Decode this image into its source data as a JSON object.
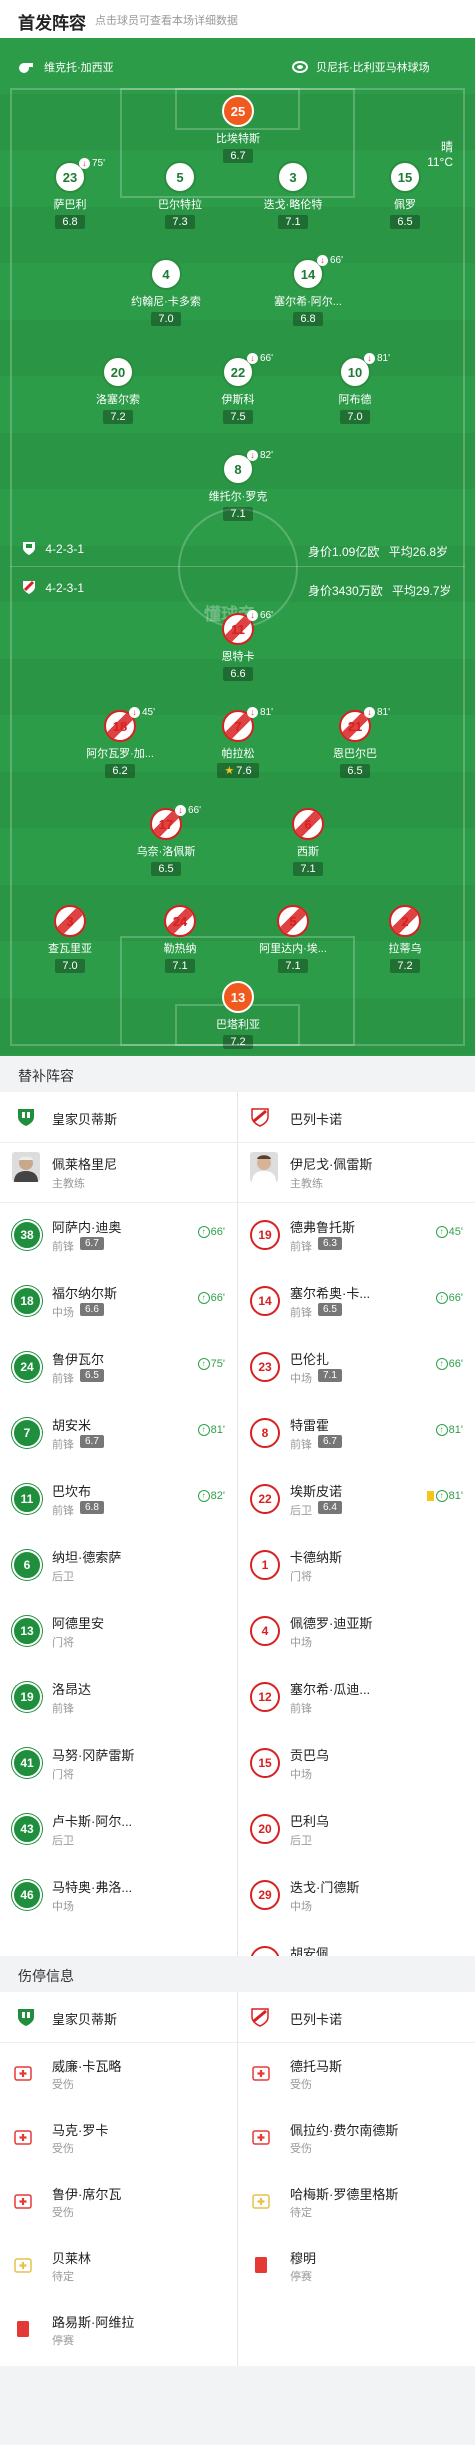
{
  "header": {
    "title": "首发阵容",
    "hint": "点击球员可查看本场详细数据"
  },
  "match": {
    "home_venue": "维克托·加西亚",
    "away_venue": "贝尼托·比利亚马林球场",
    "weather": "晴",
    "temperature": "11°C",
    "watermark": "懂球帝"
  },
  "home": {
    "formation": "4-2-3-1",
    "value": "身价1.09亿欧",
    "age": "平均26.8岁",
    "lineup": [
      {
        "num": "25",
        "name": "比埃特斯",
        "rating": "6.7",
        "gk": true
      },
      {
        "num": "23",
        "name": "萨巴利",
        "rating": "6.8",
        "sub": "75'"
      },
      {
        "num": "5",
        "name": "巴尔特拉",
        "rating": "7.3"
      },
      {
        "num": "3",
        "name": "迭戈·略伦特",
        "rating": "7.1"
      },
      {
        "num": "15",
        "name": "佩罗",
        "rating": "6.5"
      },
      {
        "num": "4",
        "name": "约翰尼·卡多索",
        "rating": "7.0"
      },
      {
        "num": "14",
        "name": "塞尔希·阿尔...",
        "rating": "6.8",
        "sub": "66'"
      },
      {
        "num": "20",
        "name": "洛塞尔索",
        "rating": "7.2"
      },
      {
        "num": "22",
        "name": "伊斯科",
        "rating": "7.5",
        "sub": "66'"
      },
      {
        "num": "10",
        "name": "阿布德",
        "rating": "7.0",
        "sub": "81'"
      },
      {
        "num": "8",
        "name": "维托尔·罗克",
        "rating": "7.1",
        "sub": "82'"
      }
    ]
  },
  "away": {
    "formation": "4-2-3-1",
    "value": "身价3430万欧",
    "age": "平均29.7岁",
    "lineup": [
      {
        "num": "11",
        "name": "恩特卡",
        "rating": "6.6",
        "sub": "66'"
      },
      {
        "num": "18",
        "name": "阿尔瓦罗·加...",
        "rating": "6.2",
        "sub": "45'"
      },
      {
        "num": "7",
        "name": "帕拉松",
        "rating": "7.6",
        "sub": "81'"
      },
      {
        "num": "21",
        "name": "恩巴尔巴",
        "rating": "6.5",
        "sub": "81'"
      },
      {
        "num": "17",
        "name": "乌奈·洛佩斯",
        "rating": "6.5",
        "sub": "66'"
      },
      {
        "num": "6",
        "name": "西斯",
        "rating": "7.1"
      },
      {
        "num": "3",
        "name": "查瓦里亚",
        "rating": "7.0"
      },
      {
        "num": "24",
        "name": "勒热纳",
        "rating": "7.1"
      },
      {
        "num": "5",
        "name": "阿里达内·埃...",
        "rating": "7.1"
      },
      {
        "num": "2",
        "name": "拉蒂乌",
        "rating": "7.2"
      },
      {
        "num": "13",
        "name": "巴塔利亚",
        "rating": "7.2",
        "gk": true
      }
    ]
  },
  "subs": {
    "title": "替补阵容",
    "home_team": "皇家贝蒂斯",
    "away_team": "巴列卡诺",
    "home_coach": {
      "name": "佩莱格里尼",
      "role": "主教练"
    },
    "away_coach": {
      "name": "伊尼戈·佩雷斯",
      "role": "主教练"
    },
    "home": [
      {
        "num": "38",
        "name": "阿萨内·迪奥",
        "pos": "前锋",
        "rating": "6.7",
        "time": "66'"
      },
      {
        "num": "18",
        "name": "福尔纳尔斯",
        "pos": "中场",
        "rating": "6.6",
        "time": "66'"
      },
      {
        "num": "24",
        "name": "鲁伊瓦尔",
        "pos": "前锋",
        "rating": "6.5",
        "time": "75'"
      },
      {
        "num": "7",
        "name": "胡安米",
        "pos": "前锋",
        "rating": "6.7",
        "time": "81'"
      },
      {
        "num": "11",
        "name": "巴坎布",
        "pos": "前锋",
        "rating": "6.8",
        "time": "82'"
      },
      {
        "num": "6",
        "name": "纳坦·德索萨",
        "pos": "后卫"
      },
      {
        "num": "13",
        "name": "阿德里安",
        "pos": "门将"
      },
      {
        "num": "19",
        "name": "洛昂达",
        "pos": "前锋"
      },
      {
        "num": "41",
        "name": "马努·冈萨雷斯",
        "pos": "门将"
      },
      {
        "num": "43",
        "name": "卢卡斯·阿尔...",
        "pos": "后卫"
      },
      {
        "num": "46",
        "name": "马特奥·弗洛...",
        "pos": "中场"
      }
    ],
    "away": [
      {
        "num": "19",
        "name": "德弗鲁托斯",
        "pos": "前锋",
        "rating": "6.3",
        "time": "45'"
      },
      {
        "num": "14",
        "name": "塞尔希奥·卡...",
        "pos": "前锋",
        "rating": "6.5",
        "time": "66'"
      },
      {
        "num": "23",
        "name": "巴伦扎",
        "pos": "中场",
        "rating": "7.1",
        "time": "66'"
      },
      {
        "num": "8",
        "name": "特雷霍",
        "pos": "前锋",
        "rating": "6.7",
        "time": "81'"
      },
      {
        "num": "22",
        "name": "埃斯皮诺",
        "pos": "后卫",
        "rating": "6.4",
        "time": "81'",
        "ycard": true
      },
      {
        "num": "1",
        "name": "卡德纳斯",
        "pos": "门将"
      },
      {
        "num": "4",
        "name": "佩德罗·迪亚斯",
        "pos": "中场"
      },
      {
        "num": "12",
        "name": "塞尔希·瓜迪...",
        "pos": "前锋"
      },
      {
        "num": "15",
        "name": "贡巴乌",
        "pos": "中场"
      },
      {
        "num": "20",
        "name": "巴利乌",
        "pos": "后卫"
      },
      {
        "num": "29",
        "name": "迭戈·门德斯",
        "pos": "中场"
      },
      {
        "num": "30",
        "name": "胡安佩",
        "pos": "中场"
      }
    ]
  },
  "injuries": {
    "title": "伤停信息",
    "home": [
      {
        "name": "威廉·卡瓦略",
        "status": "受伤",
        "type": "injury"
      },
      {
        "name": "马克·罗卡",
        "status": "受伤",
        "type": "injury"
      },
      {
        "name": "鲁伊·席尔瓦",
        "status": "受伤",
        "type": "injury"
      },
      {
        "name": "贝莱林",
        "status": "待定",
        "type": "doubt"
      },
      {
        "name": "路易斯·阿维拉",
        "status": "停赛",
        "type": "suspend"
      }
    ],
    "away": [
      {
        "name": "德托马斯",
        "status": "受伤",
        "type": "injury"
      },
      {
        "name": "佩拉约·费尔南德斯",
        "status": "受伤",
        "type": "injury"
      },
      {
        "name": "哈梅斯·罗德里格斯",
        "status": "待定",
        "type": "doubt"
      },
      {
        "name": "穆明",
        "status": "停赛",
        "type": "suspend"
      }
    ]
  },
  "colors": {
    "pitch": "#2d9c49",
    "home": "#1f8f3d",
    "away": "#d82020",
    "gk": "#f05a1e"
  }
}
